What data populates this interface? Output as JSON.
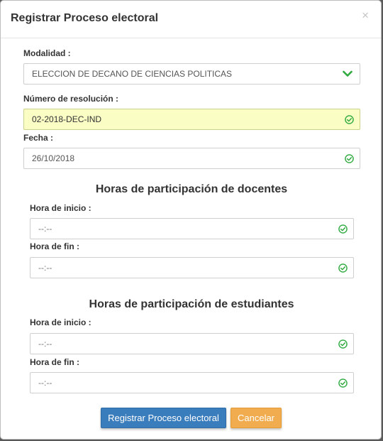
{
  "modal": {
    "title": "Registrar Proceso electoral",
    "close": "×"
  },
  "form": {
    "modalidad_label": "Modalidad :",
    "modalidad_value": "ELECCION DE DECANO DE CIENCIAS POLITICAS",
    "resolucion_label": "Número de resolución :",
    "resolucion_value": "02-2018-DEC-IND",
    "fecha_label": "Fecha :",
    "fecha_value": "26/10/2018"
  },
  "docentes": {
    "heading": "Horas de participación de docentes",
    "inicio_label": "Hora de inicio :",
    "inicio_value": "--:--",
    "fin_label": "Hora de fin :",
    "fin_value": "--:--"
  },
  "estudiantes": {
    "heading": "Horas de participación de estudiantes",
    "inicio_label": "Hora de inicio :",
    "inicio_value": "--:--",
    "fin_label": "Hora de fin :",
    "fin_value": "--:--"
  },
  "buttons": {
    "register": "Registrar Proceso electoral",
    "cancel": "Cancelar"
  },
  "colors": {
    "valid_green": "#2eaa3e",
    "primary": "#3a7dbd",
    "warning": "#f0ac4e",
    "valid_background": "#fafdc4"
  },
  "icons": {
    "select_valid": "chevron-down-icon",
    "field_valid": "check-circle-icon",
    "close": "close-icon"
  }
}
